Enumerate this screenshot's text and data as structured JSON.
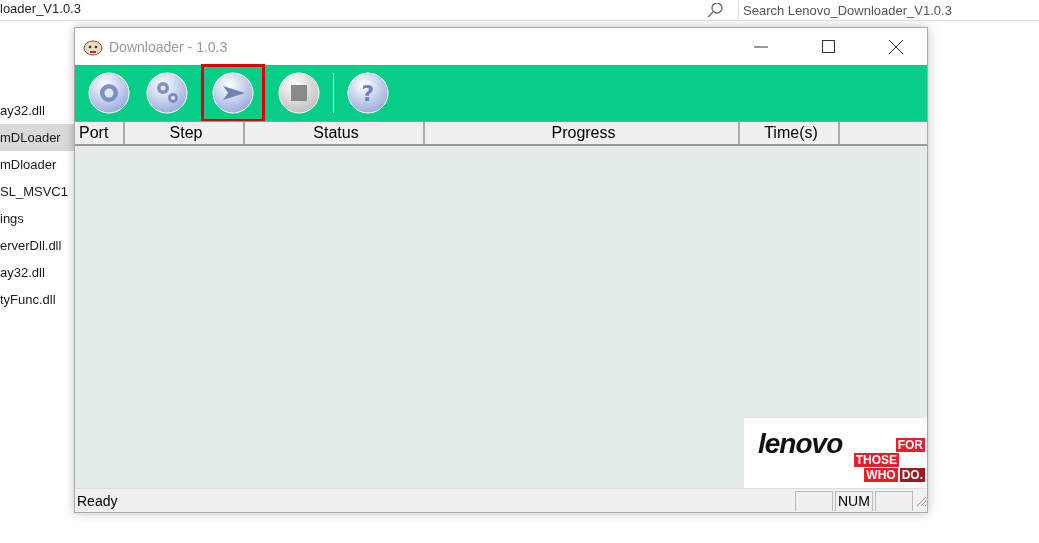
{
  "explorer": {
    "path": "loader_V1.0.3",
    "search_placeholder": "Search Lenovo_Downloader_V1.0.3",
    "files": [
      {
        "name": "ay32.dll",
        "selected": false
      },
      {
        "name": "mDLoader",
        "selected": true
      },
      {
        "name": "mDloader",
        "selected": false
      },
      {
        "name": "SL_MSVC1",
        "selected": false
      },
      {
        "name": "ings",
        "selected": false
      },
      {
        "name": "erverDll.dll",
        "selected": false
      },
      {
        "name": "ay32.dll",
        "selected": false
      },
      {
        "name": "tyFunc.dll",
        "selected": false
      }
    ]
  },
  "window": {
    "title": "Downloader - 1.0.3"
  },
  "toolbar": [
    {
      "kind": "settings",
      "selected": false,
      "disabled": false
    },
    {
      "kind": "options",
      "selected": false,
      "disabled": false
    },
    {
      "kind": "start",
      "selected": true,
      "disabled": false
    },
    {
      "kind": "stop",
      "selected": false,
      "disabled": true
    },
    {
      "kind": "help",
      "selected": false,
      "disabled": false,
      "glyph": "?"
    }
  ],
  "table": {
    "columns": [
      "Port",
      "Step",
      "Status",
      "Progress",
      "Time(s)"
    ]
  },
  "logo": {
    "brand": "lenovo",
    "tagline": [
      "FOR",
      "THOSE",
      "WHO",
      "DO."
    ]
  },
  "status_bar": {
    "text": "Ready",
    "indicators": [
      "NUM"
    ]
  }
}
